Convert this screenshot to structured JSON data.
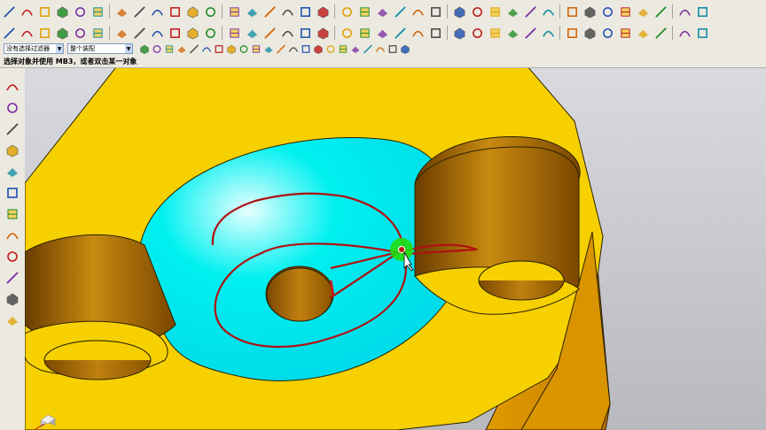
{
  "toolbar_row3": {
    "filter_value": "没有选择过滤器",
    "assembly_value": "整个装配"
  },
  "status": {
    "prompt": "选择对象并使用 MB3，或者双击某一对象"
  },
  "colors": {
    "part_yellow": "#f6d000",
    "part_edge": "#2a2000",
    "pocket_cyan": "#00f0f0",
    "hole_brown": "#a86a00",
    "toolpath_red": "#b01010",
    "marker_green": "#22dd11"
  },
  "icons": {
    "row1": [
      "line-icon",
      "arc-icon",
      "rectangle-icon",
      "spline-icon",
      "text-icon",
      "sketch-icon",
      "point-icon",
      "dimension-icon",
      "transform-icon",
      "view-icon",
      "orient-icon",
      "fillet-icon",
      "chamfer-icon",
      "trim-icon",
      "mirror-icon",
      "edit-icon",
      "measure-icon",
      "layer-icon",
      "display-icon",
      "shade-icon",
      "wireframe-icon",
      "render-icon",
      "section-icon",
      "color-icon"
    ],
    "row2": [
      "csys-icon",
      "datum-icon",
      "extrude-icon",
      "revolve-icon",
      "hole-icon",
      "boss-icon",
      "pocket-icon",
      "pattern-icon",
      "unite-icon",
      "subtract-icon",
      "block-icon",
      "cylinder-icon",
      "cone-icon",
      "sphere-icon",
      "blend-icon",
      "draft-icon",
      "shell-icon",
      "offset-icon",
      "thread-icon",
      "rib-icon",
      "replace-icon",
      "trim-body-icon",
      "split-icon",
      "sew-icon"
    ],
    "resource": [
      "assembly-navigator-icon",
      "constraint-navigator-icon",
      "part-navigator-icon",
      "reuse-library-icon",
      "web-browser-icon",
      "history-icon",
      "clock-icon",
      "report-icon",
      "process-icon",
      "palette-icon",
      "roles-icon",
      "system-materials-icon"
    ]
  }
}
